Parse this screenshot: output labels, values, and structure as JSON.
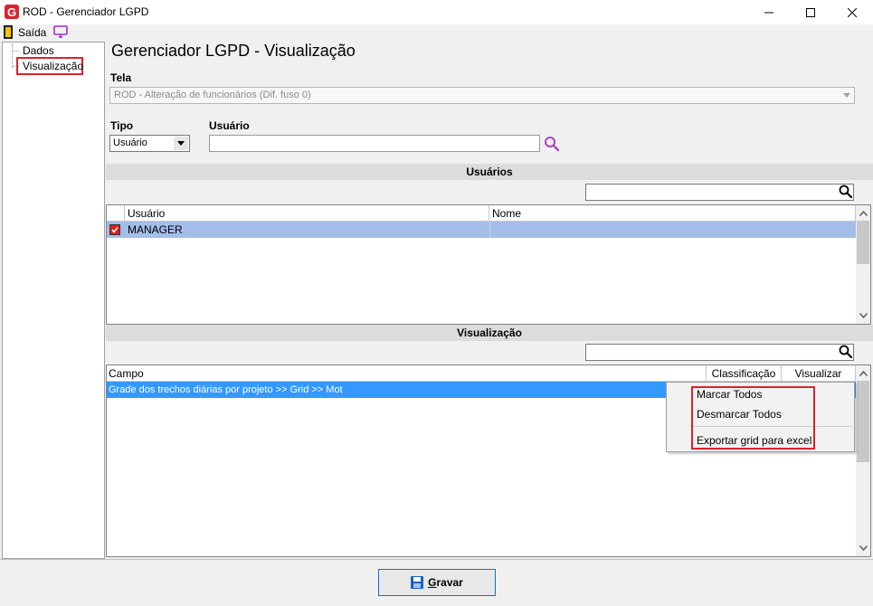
{
  "window": {
    "title": "ROD - Gerenciador LGPD"
  },
  "menubar": {
    "exit_label": "Saída"
  },
  "tree": {
    "items": [
      {
        "label": "Dados"
      },
      {
        "label": "Visualização"
      }
    ]
  },
  "page": {
    "title": "Gerenciador LGPD - Visualização",
    "tela_label": "Tela",
    "tela_value": "ROD - Alteração de funcionários (Dif. fuso 0)",
    "tipo_label": "Tipo",
    "tipo_value": "Usuário",
    "usuario_label": "Usuário",
    "usuario_value": ""
  },
  "usuarios_section": {
    "header": "Usuários",
    "filter_value": "",
    "columns": [
      "Usuário",
      "Nome"
    ],
    "rows": [
      {
        "checked": true,
        "usuario": "MANAGER",
        "nome": ""
      }
    ]
  },
  "visualizacao_section": {
    "header": "Visualização",
    "filter_value": "",
    "columns": [
      "Campo",
      "Classificação",
      "Visualizar"
    ],
    "rows": [
      {
        "campo": "Grade dos trechos diárias por projeto >> Grid >> Mot"
      }
    ]
  },
  "context_menu": {
    "items": [
      "Marcar Todos",
      "Desmarcar Todos",
      "Exportar grid para excel"
    ]
  },
  "footer": {
    "save_mnemonic": "G",
    "save_rest": "ravar"
  },
  "colors": {
    "accent_red": "#d9232d",
    "selection_blue": "#3399ff",
    "row_highlight": "#a4bde9",
    "app_icon_red": "#d9232d"
  }
}
